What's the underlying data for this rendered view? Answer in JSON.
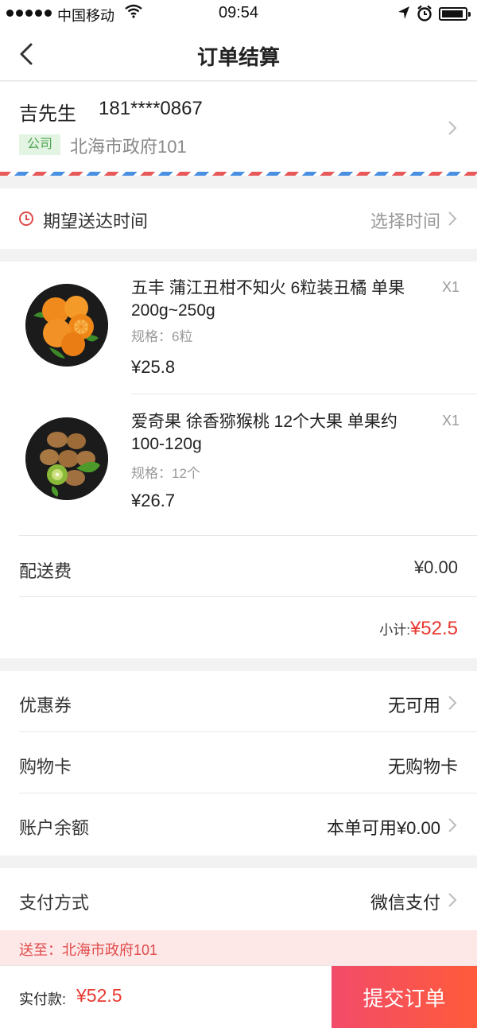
{
  "status_bar": {
    "carrier": "中国移动",
    "time": "09:54"
  },
  "navbar": {
    "title": "订单结算"
  },
  "address": {
    "name": "吉先生",
    "phone": "181****0867",
    "tag": "公司",
    "detail": "北海市政府101"
  },
  "delivery_time": {
    "label": "期望送达时间",
    "value": "选择时间"
  },
  "products": [
    {
      "title": "五丰 蒲江丑柑不知火 6粒装丑橘 单果200g~250g",
      "spec": "规格：6粒",
      "price": "¥25.8",
      "qty": "X1"
    },
    {
      "title": "爱奇果 徐香猕猴桃 12个大果 单果约100-120g",
      "spec": "规格：12个",
      "price": "¥26.7",
      "qty": "X1"
    }
  ],
  "delivery_fee": {
    "label": "配送费",
    "value": "¥0.00"
  },
  "subtotal": {
    "label": "小计:",
    "value": "¥52.5"
  },
  "options": {
    "coupon": {
      "label": "优惠券",
      "value": "无可用"
    },
    "shopping_card": {
      "label": "购物卡",
      "value": "无购物卡"
    },
    "balance": {
      "label": "账户余额",
      "value": "本单可用¥0.00"
    }
  },
  "payment": {
    "label": "支付方式",
    "value": "微信支付"
  },
  "send_to": "送至：北海市政府101",
  "bottom": {
    "pay_label": "实付款:",
    "pay_amount": "¥52.5",
    "submit_label": "提交订单"
  },
  "colors": {
    "accent": "#e8382f",
    "submit_start": "#f24b6a",
    "submit_end": "#ff5b3a",
    "tag_green": "#4fa552"
  }
}
